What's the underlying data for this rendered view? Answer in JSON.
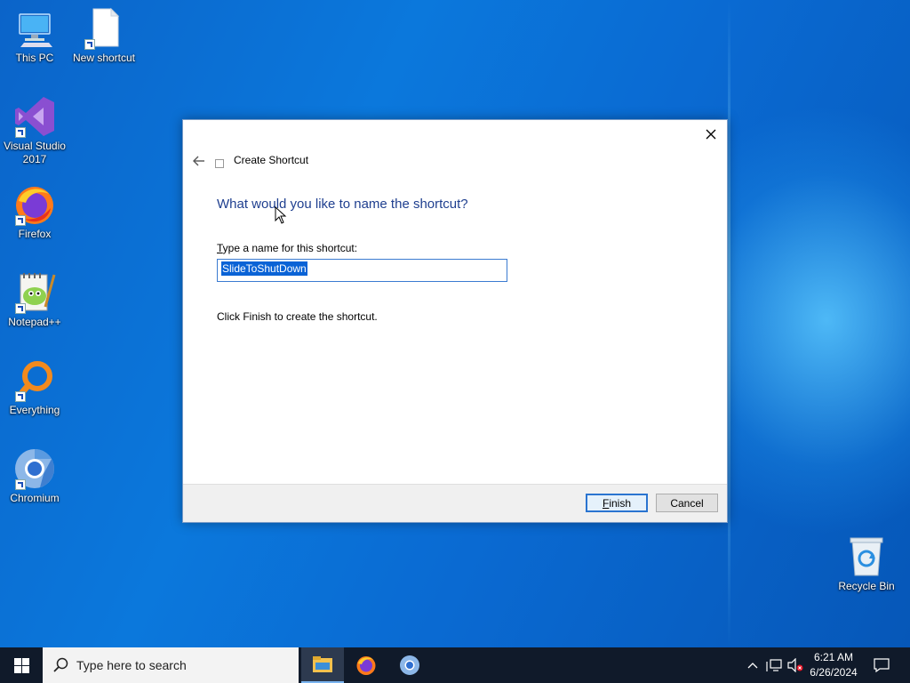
{
  "desktop": {
    "icons": [
      {
        "label": "This PC",
        "icon": "computer-icon"
      },
      {
        "label": "New shortcut",
        "icon": "blank-file-icon"
      },
      {
        "label": "Visual Studio 2017",
        "icon": "visual-studio-icon"
      },
      {
        "label": "Firefox",
        "icon": "firefox-icon"
      },
      {
        "label": "Notepad++",
        "icon": "notepadpp-icon"
      },
      {
        "label": "Everything",
        "icon": "everything-search-icon"
      },
      {
        "label": "Chromium",
        "icon": "chromium-icon"
      },
      {
        "label": "Recycle Bin",
        "icon": "recycle-bin-icon"
      }
    ]
  },
  "dialog": {
    "title": "Create Shortcut",
    "heading": "What would you like to name the shortcut?",
    "field_label_accesskey": "T",
    "field_label_rest": "ype a name for this shortcut:",
    "name_value": "SlideToShutDown",
    "hint": "Click Finish to create the shortcut.",
    "finish_accesskey": "F",
    "finish_rest": "inish",
    "cancel_label": "Cancel"
  },
  "taskbar": {
    "search_placeholder": "Type here to search",
    "time": "6:21 AM",
    "date": "6/26/2024",
    "pinned": [
      "file-explorer-icon",
      "firefox-icon",
      "chromium-icon"
    ]
  },
  "colors": {
    "accent": "#0a63d6",
    "heading": "#1f3f8f",
    "taskbar": "#101a2a"
  }
}
